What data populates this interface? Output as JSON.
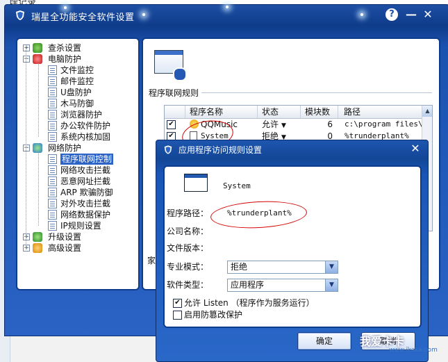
{
  "main_window": {
    "title": "瑞星全功能安全软件设置",
    "help_label": "?",
    "minimize_label": "—",
    "close_label": "✕"
  },
  "tree": {
    "items": [
      {
        "label": "查杀设置",
        "level": 0,
        "expander": "+"
      },
      {
        "label": "电脑防护",
        "level": 0,
        "expander": "−"
      },
      {
        "label": "文件监控",
        "level": 1
      },
      {
        "label": "邮件监控",
        "level": 1
      },
      {
        "label": "U盘防护",
        "level": 1
      },
      {
        "label": "木马防御",
        "level": 1
      },
      {
        "label": "浏览器防护",
        "level": 1
      },
      {
        "label": "办公软件防护",
        "level": 1
      },
      {
        "label": "系统内核加固",
        "level": 1
      },
      {
        "label": "网络防护",
        "level": 0,
        "expander": "−"
      },
      {
        "label": "程序联网控制",
        "level": 1,
        "selected": true
      },
      {
        "label": "网络攻击拦截",
        "level": 1
      },
      {
        "label": "恶意网址拦截",
        "level": 1
      },
      {
        "label": "ARP 欺骗防御",
        "level": 1
      },
      {
        "label": "对外攻击拦截",
        "level": 1
      },
      {
        "label": "网络数据保护",
        "level": 1
      },
      {
        "label": "IP规则设置",
        "level": 1
      },
      {
        "label": "升级设置",
        "level": 0,
        "expander": "+"
      },
      {
        "label": "高级设置",
        "level": 0,
        "expander": "+"
      }
    ]
  },
  "content": {
    "section_title": "程序联网规则",
    "partial_text": "家",
    "table": {
      "headers": [
        "程序名称",
        "状态",
        "模块数",
        "路径"
      ],
      "rows": [
        {
          "checked": true,
          "name": "QQMusic",
          "status": "允许",
          "modules": "6",
          "path": "c:\\program files\\t"
        },
        {
          "checked": true,
          "name": "System",
          "status": "拒绝",
          "modules": "0",
          "path": "%trunderplant%"
        }
      ]
    }
  },
  "dialog": {
    "title": "应用程序访问规则设置",
    "close_label": "✕",
    "program_name": "System",
    "path_label": "程序路径：",
    "path_value": "%trunderplant%",
    "company_label": "公司名称：",
    "company_value": "",
    "version_label": "文件版本：",
    "version_value": "",
    "mode_label": "专业模式：",
    "mode_value": "拒绝",
    "type_label": "软件类型：",
    "type_value": "应用程序",
    "listen_label": "允许 Listen （程序作为服务运行）",
    "listen_checked": true,
    "tamper_label": "启用防篡改保护",
    "tamper_checked": false,
    "ok_label": "确定",
    "cancel_label": "取消"
  },
  "background": {
    "top_text": "处理记录"
  },
  "watermark": {
    "main": "我爱卡卡",
    "sub": "www.ikaka.com"
  },
  "colors": {
    "title_blue": "#1d4fa4",
    "panel_border": "#0d3b8c",
    "selection": "#2c63c7",
    "annotation_red": "#d40000"
  }
}
